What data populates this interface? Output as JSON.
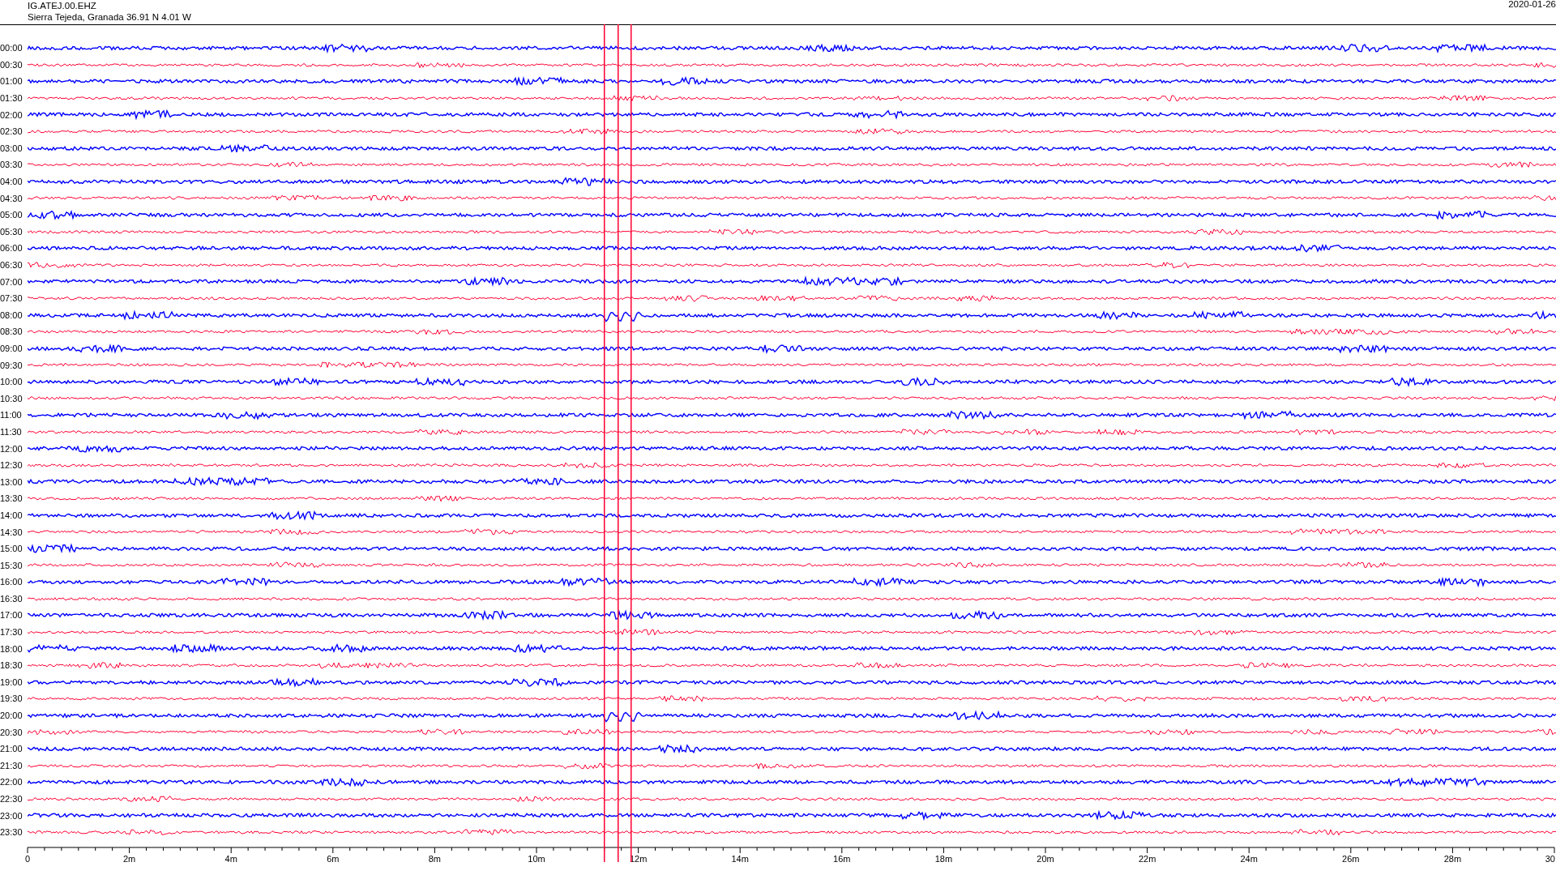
{
  "header": {
    "station": "IG.ATEJ.00.EHZ",
    "location": "Sierra Tejeda, Granada  36.91 N 4.01 W",
    "date": "2020-01-26"
  },
  "rows": [
    {
      "label": "00:00",
      "color": "#0000ff"
    },
    {
      "label": "00:30",
      "color": "#ff0033"
    },
    {
      "label": "01:00",
      "color": "#0000ff"
    },
    {
      "label": "01:30",
      "color": "#ff0033"
    },
    {
      "label": "02:00",
      "color": "#0000ff"
    },
    {
      "label": "02:30",
      "color": "#ff0033"
    },
    {
      "label": "03:00",
      "color": "#0000ff"
    },
    {
      "label": "03:30",
      "color": "#ff0033"
    },
    {
      "label": "04:00",
      "color": "#0000ff"
    },
    {
      "label": "04:30",
      "color": "#ff0033"
    },
    {
      "label": "05:00",
      "color": "#0000ff"
    },
    {
      "label": "05:30",
      "color": "#ff0033"
    },
    {
      "label": "06:00",
      "color": "#0000ff"
    },
    {
      "label": "06:30",
      "color": "#ff0033"
    },
    {
      "label": "07:00",
      "color": "#0000ff"
    },
    {
      "label": "07:30",
      "color": "#ff0033"
    },
    {
      "label": "08:00",
      "color": "#0000ff"
    },
    {
      "label": "08:30",
      "color": "#ff0033"
    },
    {
      "label": "09:00",
      "color": "#0000ff"
    },
    {
      "label": "09:30",
      "color": "#ff0033"
    },
    {
      "label": "10:00",
      "color": "#0000ff"
    },
    {
      "label": "10:30",
      "color": "#ff0033"
    },
    {
      "label": "11:00",
      "color": "#0000ff"
    },
    {
      "label": "11:30",
      "color": "#ff0033"
    },
    {
      "label": "12:00",
      "color": "#0000ff"
    },
    {
      "label": "12:30",
      "color": "#ff0033"
    },
    {
      "label": "13:00",
      "color": "#0000ff"
    },
    {
      "label": "13:30",
      "color": "#ff0033"
    },
    {
      "label": "14:00",
      "color": "#0000ff"
    },
    {
      "label": "14:30",
      "color": "#ff0033"
    },
    {
      "label": "15:00",
      "color": "#0000ff"
    },
    {
      "label": "15:30",
      "color": "#ff0033"
    },
    {
      "label": "16:00",
      "color": "#0000ff"
    },
    {
      "label": "16:30",
      "color": "#ff0033"
    },
    {
      "label": "17:00",
      "color": "#0000ff"
    },
    {
      "label": "17:30",
      "color": "#ff0033"
    },
    {
      "label": "18:00",
      "color": "#0000ff"
    },
    {
      "label": "18:30",
      "color": "#ff0033"
    },
    {
      "label": "19:00",
      "color": "#0000ff"
    },
    {
      "label": "19:30",
      "color": "#ff0033"
    },
    {
      "label": "20:00",
      "color": "#0000ff"
    },
    {
      "label": "20:30",
      "color": "#ff0033"
    },
    {
      "label": "21:00",
      "color": "#0000ff"
    },
    {
      "label": "21:30",
      "color": "#ff0033"
    },
    {
      "label": "22:00",
      "color": "#0000ff"
    },
    {
      "label": "22:30",
      "color": "#ff0033"
    },
    {
      "label": "23:00",
      "color": "#0000ff"
    },
    {
      "label": "23:30",
      "color": "#ff0033"
    }
  ],
  "x_axis": {
    "ticks": [
      "0",
      "2m",
      "4m",
      "6m",
      "8m",
      "10m",
      "12m",
      "14m",
      "16m",
      "18m",
      "20m",
      "22m",
      "24m",
      "26m",
      "28m",
      "30"
    ]
  }
}
